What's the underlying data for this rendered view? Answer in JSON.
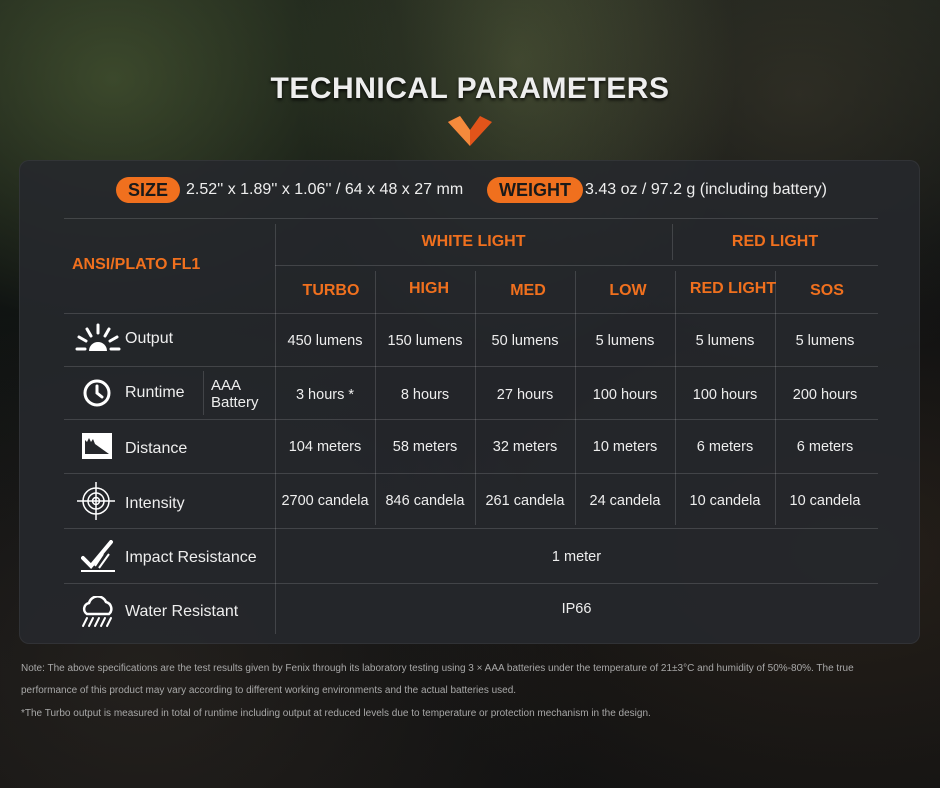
{
  "title": "TECHNICAL PARAMETERS",
  "size": {
    "label": "SIZE",
    "value": "2.52'' x 1.89'' x 1.06'' / 64 x 48 x 27 mm"
  },
  "weight": {
    "label": "WEIGHT",
    "value": "3.43 oz / 97.2 g (including battery)"
  },
  "table": {
    "standard": "ANSI/PLATO FL1",
    "group_white": "WHITE LIGHT",
    "group_red": "RED LIGHT",
    "modes": [
      "TURBO",
      "HIGH",
      "MED",
      "LOW",
      "RED LIGHT",
      "SOS"
    ],
    "rows": [
      {
        "label": "Output",
        "icon": "sunburst-icon",
        "values": [
          "450 lumens",
          "150 lumens",
          "50 lumens",
          "5 lumens",
          "5 lumens",
          "5 lumens"
        ]
      },
      {
        "label": "Runtime",
        "sublabel": [
          "AAA",
          "Battery"
        ],
        "icon": "clock-icon",
        "values": [
          "3 hours *",
          "8 hours",
          "27 hours",
          "100  hours",
          "100  hours",
          "200 hours"
        ]
      },
      {
        "label": "Distance",
        "icon": "distance-icon",
        "values": [
          "104 meters",
          "58 meters",
          "32 meters",
          "10 meters",
          "6 meters",
          "6 meters"
        ]
      },
      {
        "label": "Intensity",
        "icon": "target-icon",
        "values": [
          "2700 candela",
          "846 candela",
          "261 candela",
          "24 candela",
          "10 candela",
          "10 candela"
        ]
      },
      {
        "label": "Impact Resistance",
        "icon": "impact-icon",
        "value": "1 meter"
      },
      {
        "label": "Water Resistant",
        "icon": "rain-cloud-icon",
        "value": "IP66"
      }
    ]
  },
  "notes": [
    "Note: The above specifications are the test results given by Fenix through its laboratory testing using 3 × AAA batteries under the temperature of 21±3°C and humidity of 50%-80%. The true",
    "performance of this product may vary according to different working environments and the actual batteries used.",
    "*The Turbo output is measured in total of runtime including output at reduced levels due to temperature or protection mechanism in the design."
  ],
  "colors": {
    "accent": "#f0701e",
    "panel": "#26282c"
  }
}
